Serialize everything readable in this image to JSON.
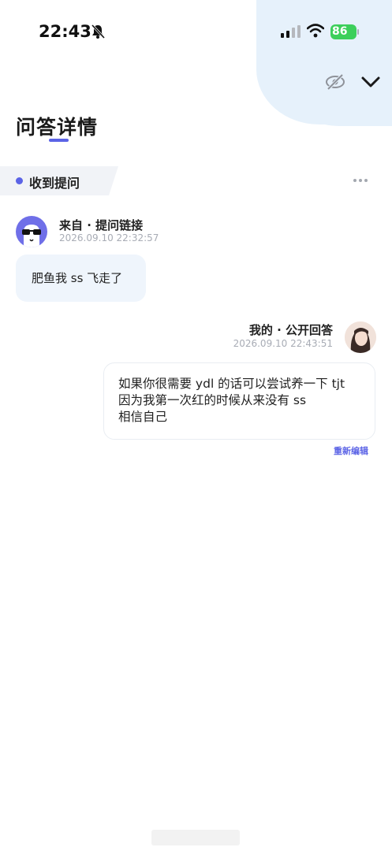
{
  "status_bar": {
    "time": "22:43",
    "battery": "86"
  },
  "header": {
    "title": "问答详情"
  },
  "question": {
    "section_label": "收到提问",
    "from_label": "来自 · 提问链接",
    "timestamp": "2026.09.10 22:32:57",
    "text": "肥鱼我 ss 飞走了"
  },
  "answer": {
    "from_label": "我的 · 公开回答",
    "timestamp": "2026.09.10 22:43:51",
    "lines": [
      "如果你很需要 ydl 的话可以尝试养一下 tjt",
      "因为我第一次红的时候从来没有 ss",
      "相信自己"
    ],
    "reedit_label": "重新编辑"
  },
  "colors": {
    "accent": "#5b63e6",
    "question_bubble": "#eff5fc",
    "header_blob": "#e6f1fb",
    "battery": "#3ccf5b"
  },
  "icons": [
    "bell-muted-icon",
    "cellular-signal-icon",
    "wifi-icon",
    "eye-off-icon",
    "chevron-down-icon",
    "more-icon"
  ]
}
